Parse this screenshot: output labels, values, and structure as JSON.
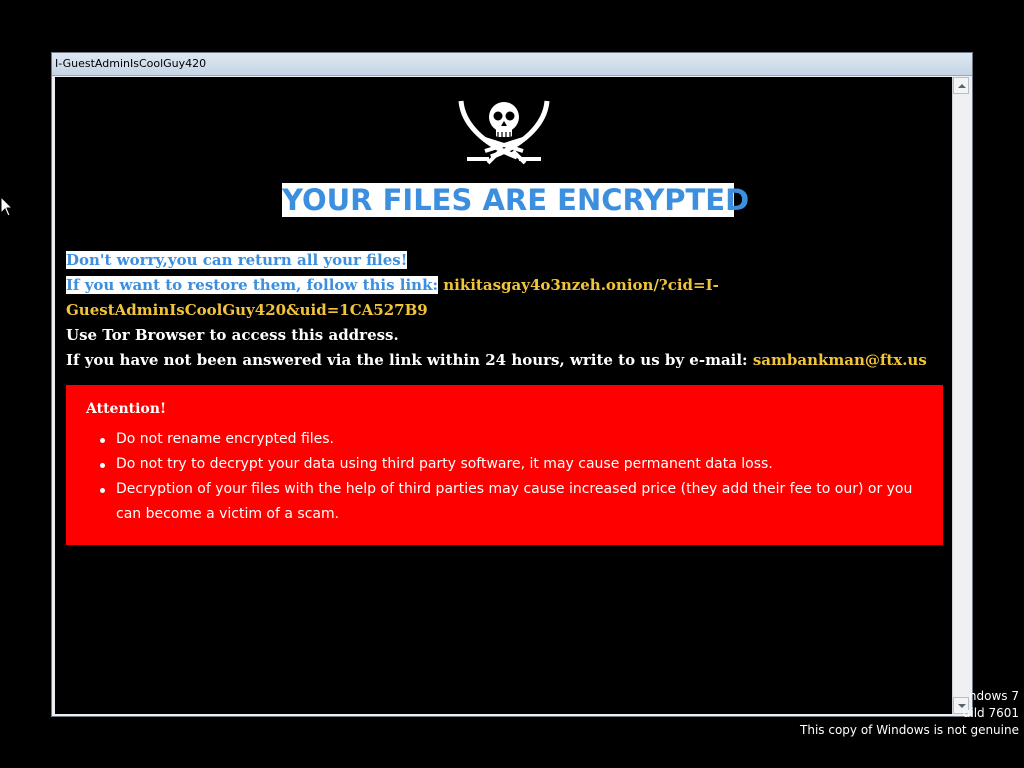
{
  "window": {
    "title": "I-GuestAdminIsCoolGuy420"
  },
  "note": {
    "headline": "YOUR FILES ARE ENCRYPTED",
    "line1": "Don't worry,you can return all your files!",
    "line2_prefix": "If you want to restore them, follow this link:",
    "link_part1": "nikitasgay4o3nzeh.onion/?cid=I-",
    "link_part2": "GuestAdminIsCoolGuy420&uid=1CA527B9",
    "tor_line": "Use Tor Browser to access this address.",
    "email_prefix": "If you have not been answered via the link within 24 hours, write to us by e-mail:",
    "email": "sambankman@ftx.us"
  },
  "attention": {
    "title": "Attention!",
    "items": [
      "Do not rename encrypted files.",
      "Do not try to decrypt your data using third party software, it may cause permanent data loss.",
      "Decryption of your files with the help of third parties may cause increased price (they add their fee to our) or you can become a victim of a scam."
    ]
  },
  "watermark": {
    "line1": "ndows 7",
    "line2": "uild 7601",
    "line3": "This copy of Windows is not genuine"
  },
  "colors": {
    "background": "#000000",
    "headline_text": "#3b8fde",
    "link_text": "#f2c43a",
    "attention_bg": "#ff0000"
  },
  "icons": [
    "skull-crossed-swords-icon",
    "mouse-cursor-icon",
    "scroll-up-arrow-icon",
    "scroll-down-arrow-icon"
  ]
}
